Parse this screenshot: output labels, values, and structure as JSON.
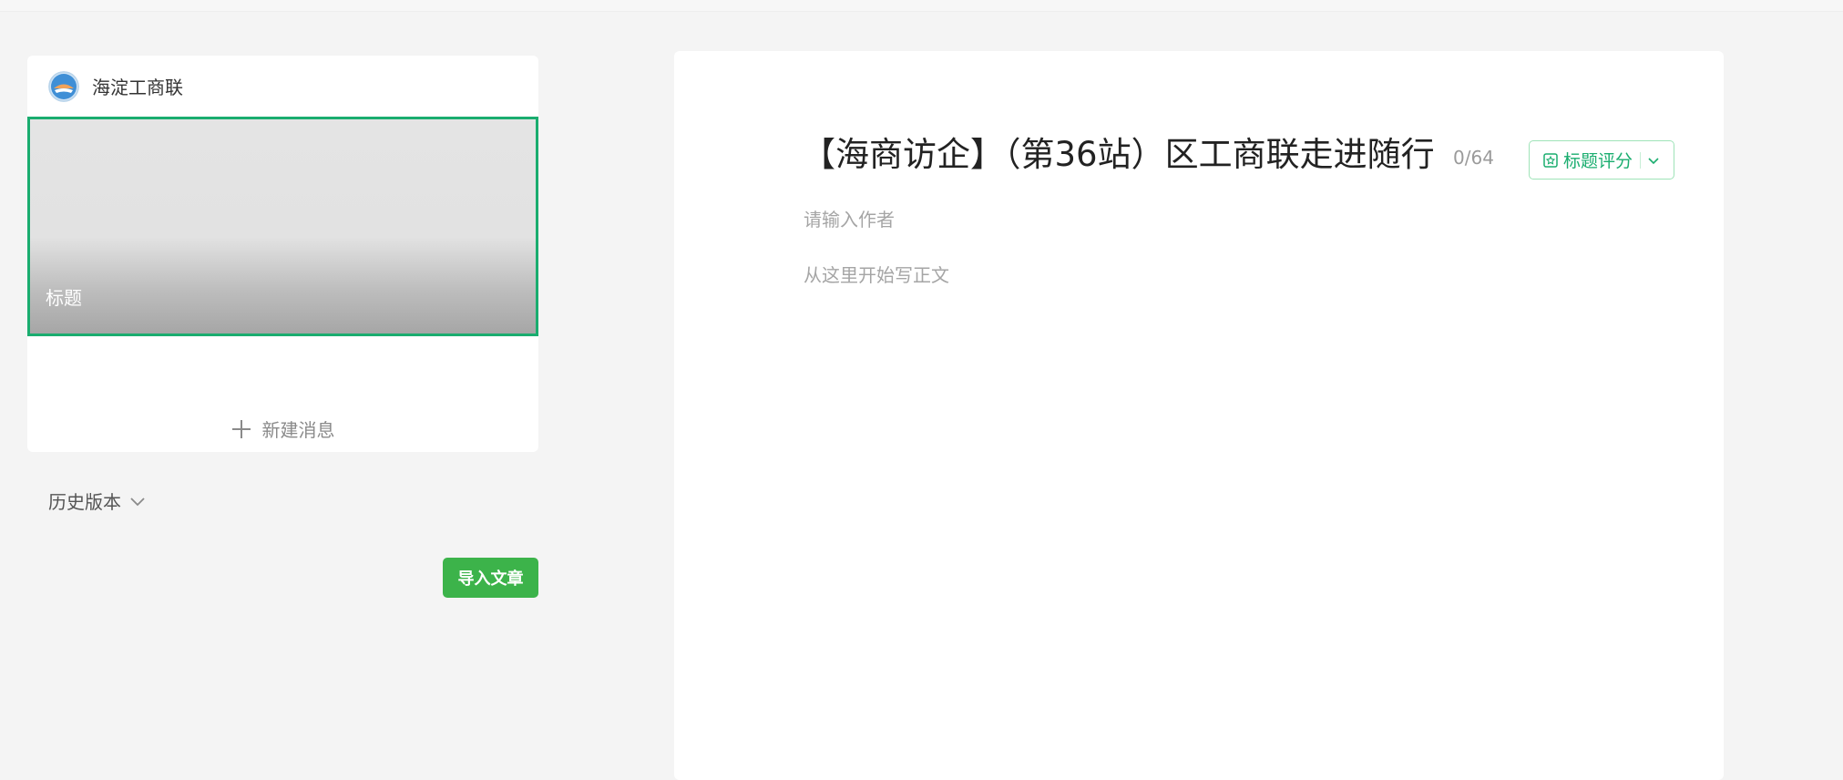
{
  "account": {
    "name": "海淀工商联",
    "avatar_icon": "organization-logo-icon"
  },
  "article_list": {
    "cover_title": "标题",
    "new_message_label": "新建消息",
    "new_message_icon": "plus-icon",
    "selected_border_color": "#1aad6f"
  },
  "history": {
    "label": "历史版本",
    "icon": "chevron-down-icon"
  },
  "import_button": {
    "label": "导入文章",
    "color": "#3cb34a"
  },
  "editor": {
    "title": "【海商访企】（第36站）区工商联走进随行",
    "title_count": "0/64",
    "score_button": {
      "label": "标题评分",
      "icon": "score-badge-icon",
      "dropdown_icon": "chevron-down-icon",
      "color": "#1aad6f"
    },
    "author_placeholder": "请输入作者",
    "body_placeholder": "从这里开始写正文"
  }
}
